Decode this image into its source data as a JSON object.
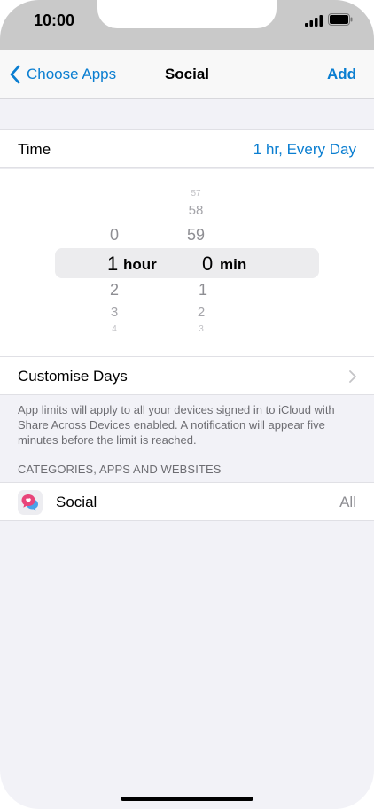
{
  "status_bar": {
    "time": "10:00"
  },
  "nav": {
    "back_label": "Choose Apps",
    "title": "Social",
    "add_label": "Add"
  },
  "time_row": {
    "label": "Time",
    "value": "1 hr, Every Day"
  },
  "picker": {
    "hours_above": [
      "0"
    ],
    "hours_selected": "1",
    "hours_below": [
      "2",
      "3",
      "4"
    ],
    "hour_unit": "hour",
    "minutes_above": [
      "57",
      "58",
      "59"
    ],
    "minutes_selected": "0",
    "minutes_below": [
      "1",
      "2",
      "3"
    ],
    "minute_unit": "min"
  },
  "customise_days": {
    "label": "Customise Days"
  },
  "footnote": "App limits will apply to all your devices signed in to iCloud with Share Across Devices enabled. A notification will appear five minutes before the limit is reached.",
  "section_header": "CATEGORIES, APPS AND WEBSITES",
  "social_row": {
    "label": "Social",
    "value": "All",
    "icon": "social-speech-bubbles-icon"
  },
  "colors": {
    "accent": "#0a7ed1",
    "secondary_text": "#8e8e93",
    "background": "#f2f2f7",
    "icon_pink": "#e8457a",
    "icon_blue": "#4aa3e8"
  }
}
